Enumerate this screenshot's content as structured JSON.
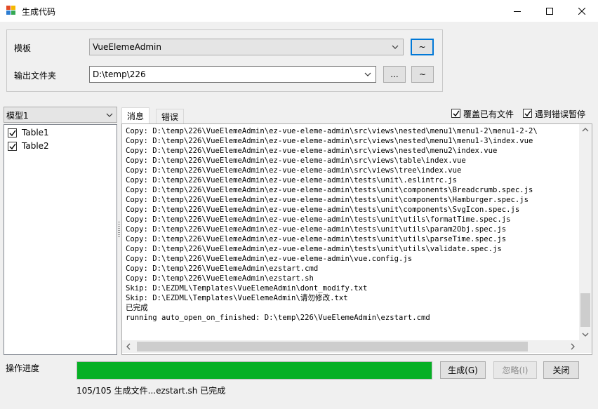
{
  "window": {
    "title": "生成代码",
    "icon": "app-grid-icon"
  },
  "template_row": {
    "label": "模板",
    "value": "VueElemeAdmin",
    "button": "~"
  },
  "output_row": {
    "label": "输出文件夹",
    "value": "D:\\temp\\226",
    "browse_button": "...",
    "menu_button": "~"
  },
  "model": {
    "selected": "模型1",
    "tables": [
      {
        "label": "Table1",
        "checked": true
      },
      {
        "label": "Table2",
        "checked": true
      }
    ]
  },
  "tabs": [
    {
      "label": "消息",
      "active": true
    },
    {
      "label": "错误",
      "active": false
    }
  ],
  "options": {
    "overwrite": {
      "label": "覆盖已有文件",
      "checked": true
    },
    "pause_on_error": {
      "label": "遇到错误暂停",
      "checked": true
    }
  },
  "log": [
    "Copy: D:\\temp\\226\\VueElemeAdmin\\ez-vue-eleme-admin\\src\\views\\nested\\menu1\\menu1-2\\menu1-2-2\\",
    "Copy: D:\\temp\\226\\VueElemeAdmin\\ez-vue-eleme-admin\\src\\views\\nested\\menu1\\menu1-3\\index.vue",
    "Copy: D:\\temp\\226\\VueElemeAdmin\\ez-vue-eleme-admin\\src\\views\\nested\\menu2\\index.vue",
    "Copy: D:\\temp\\226\\VueElemeAdmin\\ez-vue-eleme-admin\\src\\views\\table\\index.vue",
    "Copy: D:\\temp\\226\\VueElemeAdmin\\ez-vue-eleme-admin\\src\\views\\tree\\index.vue",
    "Copy: D:\\temp\\226\\VueElemeAdmin\\ez-vue-eleme-admin\\tests\\unit\\.eslintrc.js",
    "Copy: D:\\temp\\226\\VueElemeAdmin\\ez-vue-eleme-admin\\tests\\unit\\components\\Breadcrumb.spec.js",
    "Copy: D:\\temp\\226\\VueElemeAdmin\\ez-vue-eleme-admin\\tests\\unit\\components\\Hamburger.spec.js",
    "Copy: D:\\temp\\226\\VueElemeAdmin\\ez-vue-eleme-admin\\tests\\unit\\components\\SvgIcon.spec.js",
    "Copy: D:\\temp\\226\\VueElemeAdmin\\ez-vue-eleme-admin\\tests\\unit\\utils\\formatTime.spec.js",
    "Copy: D:\\temp\\226\\VueElemeAdmin\\ez-vue-eleme-admin\\tests\\unit\\utils\\param2Obj.spec.js",
    "Copy: D:\\temp\\226\\VueElemeAdmin\\ez-vue-eleme-admin\\tests\\unit\\utils\\parseTime.spec.js",
    "Copy: D:\\temp\\226\\VueElemeAdmin\\ez-vue-eleme-admin\\tests\\unit\\utils\\validate.spec.js",
    "Copy: D:\\temp\\226\\VueElemeAdmin\\ez-vue-eleme-admin\\vue.config.js",
    "Copy: D:\\temp\\226\\VueElemeAdmin\\ezstart.cmd",
    "Copy: D:\\temp\\226\\VueElemeAdmin\\ezstart.sh",
    "Skip: D:\\EZDML\\Templates\\VueElemeAdmin\\dont_modify.txt",
    "Skip: D:\\EZDML\\Templates\\VueElemeAdmin\\请勿修改.txt",
    "已完成",
    "running auto_open_on_finished: D:\\temp\\226\\VueElemeAdmin\\ezstart.cmd"
  ],
  "progress": {
    "label": "操作进度",
    "fraction": 1.0,
    "status": "105/105 生成文件...ezstart.sh 已完成",
    "color": "#06b025"
  },
  "buttons": {
    "generate": "生成(G)",
    "ignore": "忽略(I)",
    "close": "关闭"
  }
}
